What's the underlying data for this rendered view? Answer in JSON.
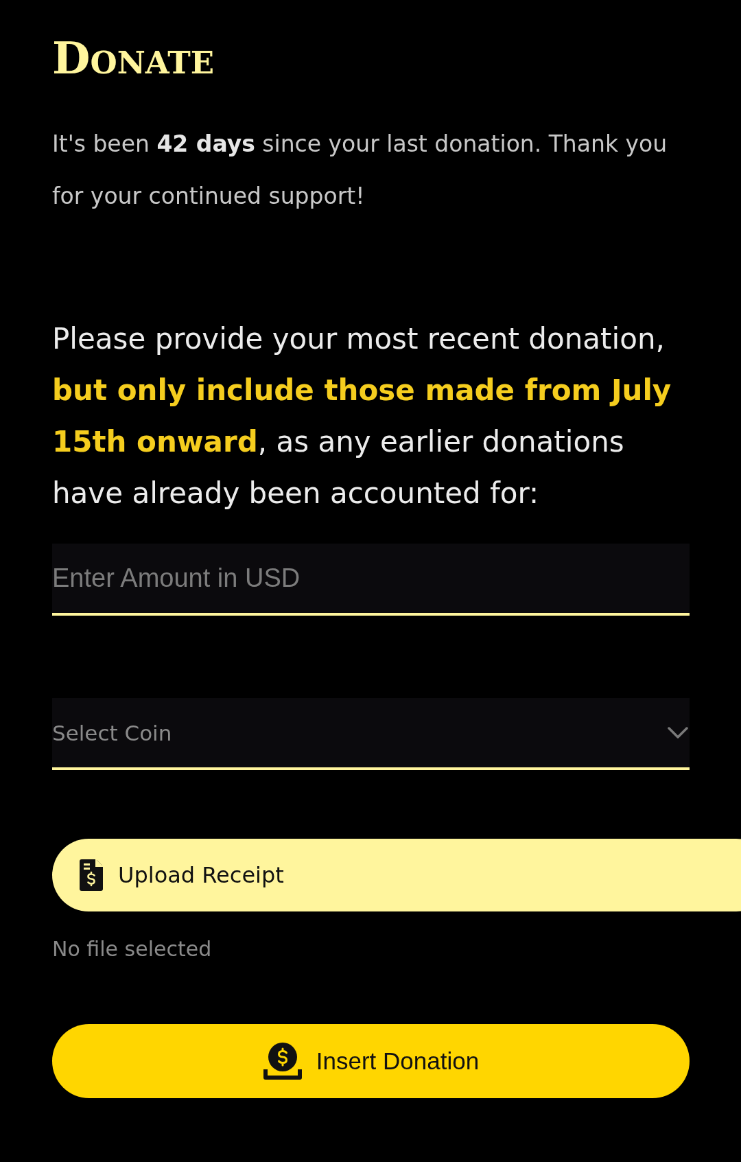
{
  "title": "Donate",
  "intro": "It's been **42 days** since your last donation. Thank you for your continued support!",
  "instruction": [
    {
      "text": "Please provide your most recent donation, ",
      "highlight": false
    },
    {
      "text": "but only include those made from July 15th onward",
      "highlight": true
    },
    {
      "text": ", as any earlier donations have already been accounted for:",
      "highlight": false
    }
  ],
  "amount_field": {
    "placeholder": "Enter Amount in USD"
  },
  "coin_select": {
    "placeholder": "Select Coin"
  },
  "upload_button": {
    "label": "Upload Receipt"
  },
  "file_status": "No file selected",
  "submit_button": {
    "label": "Insert Donation"
  }
}
